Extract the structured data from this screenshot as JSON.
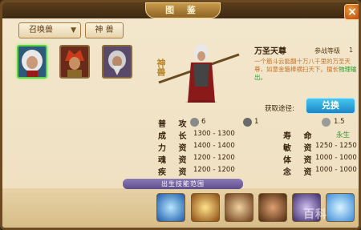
{
  "window": {
    "title": "图 鉴",
    "close_icon": "×"
  },
  "filters": {
    "category_label": "召唤兽",
    "type_label": "神 兽"
  },
  "roster": [
    {
      "name": "万圣天尊",
      "selected": true
    },
    {
      "name": "红发战将",
      "selected": false
    },
    {
      "name": "银发老者",
      "selected": false
    }
  ],
  "side_title": "神兽",
  "hero": {
    "name": "万圣天尊",
    "level_label": "参战等级",
    "level_value": "1",
    "description": "一个筋斗云能翻十万八千里的万圣天尊，如意金箍棒横扫天下。擅长",
    "description_tag": "物理输出。"
  },
  "obtain": {
    "label": "获取途径:",
    "button": "兑换"
  },
  "stats": {
    "attack_label": "普 攻",
    "attack_values": [
      "6",
      "1",
      "1.5"
    ],
    "growth_label": "成 长",
    "growth_value": "1300 - 1300",
    "life_label": "寿 命",
    "life_value": "永生",
    "power_label": "力 资",
    "power_value": "1400 - 1400",
    "agility_label": "敏 资",
    "agility_value": "1250 - 1250",
    "soul_label": "魂 资",
    "soul_value": "1200 - 1200",
    "body_label": "体 资",
    "body_value": "1000 - 1000",
    "speed_label": "疾 资",
    "speed_value": "1200 - 1200",
    "mind_label": "念 资",
    "mind_value": "1000 - 1000"
  },
  "skills": {
    "header": "出生技能范围",
    "items": [
      "ice-skill",
      "gold-skill",
      "wind-skill",
      "vortex-skill",
      "arcane-skill",
      "frost-skill"
    ]
  },
  "watermark": "百科"
}
